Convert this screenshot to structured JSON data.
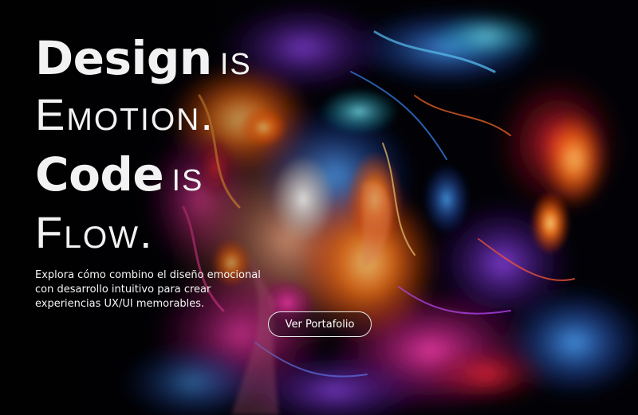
{
  "hero": {
    "headline": {
      "line1_strong": "Design",
      "line1_light": "is",
      "line2_light": "Emotion.",
      "line3_strong": "Code",
      "line3_light": "is",
      "line4_light": "Flow."
    },
    "subtitle": "Explora cómo combino el diseño emocional con desarrollo intuitivo para crear experiencias UX/UI memorables.",
    "cta_label": "Ver Portafolio",
    "background_image": "abstract-colorful-face-artwork"
  },
  "colors": {
    "background": "#020206",
    "text": "#f2f2f2",
    "button_border": "#e8e8e8"
  }
}
